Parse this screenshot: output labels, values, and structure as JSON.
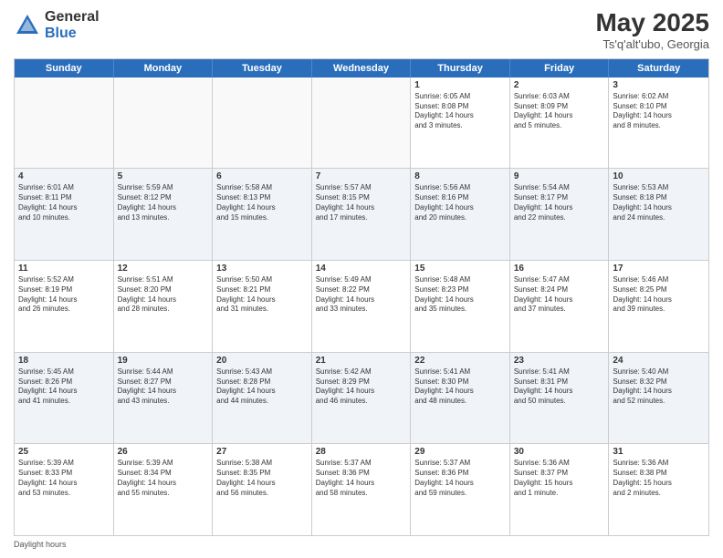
{
  "logo": {
    "general": "General",
    "blue": "Blue"
  },
  "title": "May 2025",
  "subtitle": "Ts'q'alt'ubo, Georgia",
  "days": [
    "Sunday",
    "Monday",
    "Tuesday",
    "Wednesday",
    "Thursday",
    "Friday",
    "Saturday"
  ],
  "footer_label": "Daylight hours",
  "rows": [
    [
      {
        "num": "",
        "text": ""
      },
      {
        "num": "",
        "text": ""
      },
      {
        "num": "",
        "text": ""
      },
      {
        "num": "",
        "text": ""
      },
      {
        "num": "1",
        "text": "Sunrise: 6:05 AM\nSunset: 8:08 PM\nDaylight: 14 hours\nand 3 minutes."
      },
      {
        "num": "2",
        "text": "Sunrise: 6:03 AM\nSunset: 8:09 PM\nDaylight: 14 hours\nand 5 minutes."
      },
      {
        "num": "3",
        "text": "Sunrise: 6:02 AM\nSunset: 8:10 PM\nDaylight: 14 hours\nand 8 minutes."
      }
    ],
    [
      {
        "num": "4",
        "text": "Sunrise: 6:01 AM\nSunset: 8:11 PM\nDaylight: 14 hours\nand 10 minutes."
      },
      {
        "num": "5",
        "text": "Sunrise: 5:59 AM\nSunset: 8:12 PM\nDaylight: 14 hours\nand 13 minutes."
      },
      {
        "num": "6",
        "text": "Sunrise: 5:58 AM\nSunset: 8:13 PM\nDaylight: 14 hours\nand 15 minutes."
      },
      {
        "num": "7",
        "text": "Sunrise: 5:57 AM\nSunset: 8:15 PM\nDaylight: 14 hours\nand 17 minutes."
      },
      {
        "num": "8",
        "text": "Sunrise: 5:56 AM\nSunset: 8:16 PM\nDaylight: 14 hours\nand 20 minutes."
      },
      {
        "num": "9",
        "text": "Sunrise: 5:54 AM\nSunset: 8:17 PM\nDaylight: 14 hours\nand 22 minutes."
      },
      {
        "num": "10",
        "text": "Sunrise: 5:53 AM\nSunset: 8:18 PM\nDaylight: 14 hours\nand 24 minutes."
      }
    ],
    [
      {
        "num": "11",
        "text": "Sunrise: 5:52 AM\nSunset: 8:19 PM\nDaylight: 14 hours\nand 26 minutes."
      },
      {
        "num": "12",
        "text": "Sunrise: 5:51 AM\nSunset: 8:20 PM\nDaylight: 14 hours\nand 28 minutes."
      },
      {
        "num": "13",
        "text": "Sunrise: 5:50 AM\nSunset: 8:21 PM\nDaylight: 14 hours\nand 31 minutes."
      },
      {
        "num": "14",
        "text": "Sunrise: 5:49 AM\nSunset: 8:22 PM\nDaylight: 14 hours\nand 33 minutes."
      },
      {
        "num": "15",
        "text": "Sunrise: 5:48 AM\nSunset: 8:23 PM\nDaylight: 14 hours\nand 35 minutes."
      },
      {
        "num": "16",
        "text": "Sunrise: 5:47 AM\nSunset: 8:24 PM\nDaylight: 14 hours\nand 37 minutes."
      },
      {
        "num": "17",
        "text": "Sunrise: 5:46 AM\nSunset: 8:25 PM\nDaylight: 14 hours\nand 39 minutes."
      }
    ],
    [
      {
        "num": "18",
        "text": "Sunrise: 5:45 AM\nSunset: 8:26 PM\nDaylight: 14 hours\nand 41 minutes."
      },
      {
        "num": "19",
        "text": "Sunrise: 5:44 AM\nSunset: 8:27 PM\nDaylight: 14 hours\nand 43 minutes."
      },
      {
        "num": "20",
        "text": "Sunrise: 5:43 AM\nSunset: 8:28 PM\nDaylight: 14 hours\nand 44 minutes."
      },
      {
        "num": "21",
        "text": "Sunrise: 5:42 AM\nSunset: 8:29 PM\nDaylight: 14 hours\nand 46 minutes."
      },
      {
        "num": "22",
        "text": "Sunrise: 5:41 AM\nSunset: 8:30 PM\nDaylight: 14 hours\nand 48 minutes."
      },
      {
        "num": "23",
        "text": "Sunrise: 5:41 AM\nSunset: 8:31 PM\nDaylight: 14 hours\nand 50 minutes."
      },
      {
        "num": "24",
        "text": "Sunrise: 5:40 AM\nSunset: 8:32 PM\nDaylight: 14 hours\nand 52 minutes."
      }
    ],
    [
      {
        "num": "25",
        "text": "Sunrise: 5:39 AM\nSunset: 8:33 PM\nDaylight: 14 hours\nand 53 minutes."
      },
      {
        "num": "26",
        "text": "Sunrise: 5:39 AM\nSunset: 8:34 PM\nDaylight: 14 hours\nand 55 minutes."
      },
      {
        "num": "27",
        "text": "Sunrise: 5:38 AM\nSunset: 8:35 PM\nDaylight: 14 hours\nand 56 minutes."
      },
      {
        "num": "28",
        "text": "Sunrise: 5:37 AM\nSunset: 8:36 PM\nDaylight: 14 hours\nand 58 minutes."
      },
      {
        "num": "29",
        "text": "Sunrise: 5:37 AM\nSunset: 8:36 PM\nDaylight: 14 hours\nand 59 minutes."
      },
      {
        "num": "30",
        "text": "Sunrise: 5:36 AM\nSunset: 8:37 PM\nDaylight: 15 hours\nand 1 minute."
      },
      {
        "num": "31",
        "text": "Sunrise: 5:36 AM\nSunset: 8:38 PM\nDaylight: 15 hours\nand 2 minutes."
      }
    ]
  ]
}
